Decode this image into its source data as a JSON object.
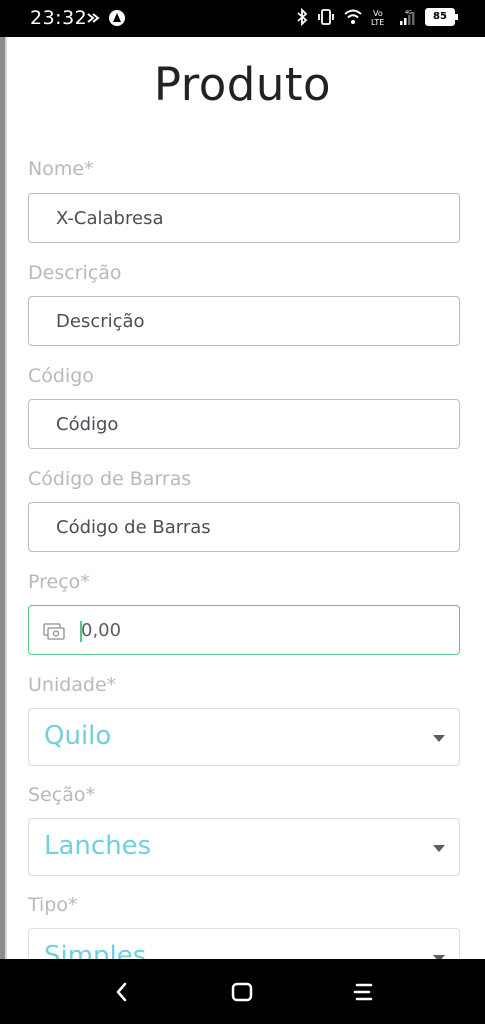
{
  "status_bar": {
    "time": "23:32",
    "battery": "85",
    "icons": [
      "notification-icon",
      "app-icon",
      "bluetooth-icon",
      "vibrate-icon",
      "wifi-icon",
      "volte-icon",
      "signal-icon",
      "battery-icon"
    ],
    "volte": "Vo\nLTE",
    "network": "4G"
  },
  "page": {
    "title": "Produto"
  },
  "form": {
    "nome": {
      "label": "Nome*",
      "value": "X-Calabresa"
    },
    "descricao": {
      "label": "Descrição",
      "placeholder": "Descrição"
    },
    "codigo": {
      "label": "Código",
      "placeholder": "Código"
    },
    "codigo_barras": {
      "label": "Código de Barras",
      "placeholder": "Código de Barras"
    },
    "preco": {
      "label": "Preço*",
      "value": "0,00",
      "icon": "cash-icon"
    },
    "unidade": {
      "label": "Unidade*",
      "value": "Quilo"
    },
    "secao": {
      "label": "Seção*",
      "value": "Lanches"
    },
    "tipo": {
      "label": "Tipo*",
      "value": "Simples"
    }
  },
  "colors": {
    "accent_green": "#59c98b",
    "select_text": "#70d0e0",
    "label_gray": "#b9b9b9"
  },
  "navbar": {
    "icons": [
      "back-icon",
      "home-icon",
      "menu-icon"
    ]
  }
}
